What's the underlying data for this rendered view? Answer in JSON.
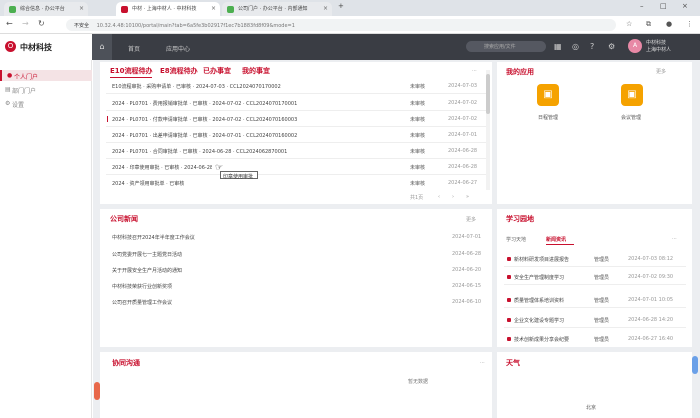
{
  "browser": {
    "tabs": [
      {
        "label": "综合信息 · 办公平台"
      },
      {
        "label": "中材 · 上海中材人 · 中材科技"
      },
      {
        "label": "公司门户 · 办公平台 · 内部通知"
      }
    ],
    "address": "10.32.4.48:10100/portal/main?tab=6a5fe3b02917f1ec7b1883fd8f09&mode=1",
    "secure_label": "不安全"
  },
  "app": {
    "logo_text": "中材科技",
    "nav": [
      "首页",
      "应用中心"
    ],
    "search_placeholder": "搜索应用/文件",
    "user_line1": "中材科技",
    "user_line2": "上海中材人"
  },
  "sidebar": {
    "items": [
      {
        "label": "个人门户",
        "icon": "person-icon"
      },
      {
        "label": "部门门户",
        "icon": "department-icon"
      },
      {
        "label": "设置",
        "icon": "gear-icon"
      }
    ]
  },
  "todo": {
    "tabs": [
      "E10流程待办",
      "E8流程待办",
      "已办事宜",
      "我的事宜"
    ],
    "rows": [
      {
        "title": "E10流程审批 · 采购申请单 · 已审核 · 2024-07-03 · CCL2024070170002",
        "status": "未审核",
        "date": "2024-07-03"
      },
      {
        "title": "2024 · PL0701 · 费用报销审批单 · 已审核 · 2024-07-02 · CCL2024070170001",
        "status": "未审核",
        "date": "2024-07-02"
      },
      {
        "title": "2024 · PL0701 · 付款申请审批单 · 已审核 · 2024-07-02 · CCL2024070160003",
        "status": "未审核",
        "date": "2024-07-02"
      },
      {
        "title": "2024 · PL0701 · 出差申请审批单 · 已审核 · 2024-07-01 · CCL2024070160002",
        "status": "未审核",
        "date": "2024-07-01"
      },
      {
        "title": "2024 · PL0701 · 合同审批单 · 已审核 · 2024-06-28 · CCL2024062870001",
        "status": "未审核",
        "date": "2024-06-28"
      },
      {
        "title": "2024 · 印章使用审批 · 已审核 · 2024-06-28",
        "status": "未审核",
        "date": "2024-06-28"
      },
      {
        "title": "2024 · 资产领用审批单 · 已审核",
        "status": "未审核",
        "date": "2024-06-27"
      }
    ],
    "tooltip": "印章使用审批",
    "pager": "共1页"
  },
  "apps": {
    "title": "我的应用",
    "more": "更多",
    "items": [
      {
        "label": "日程管理"
      },
      {
        "label": "会议管理"
      }
    ]
  },
  "notices": {
    "title": "公司新闻",
    "more": "更多",
    "rows": [
      {
        "title": "中材科技召开2024年半年度工作会议",
        "date": "2024-07-01"
      },
      {
        "title": "公司党委开展七一主题党日活动",
        "date": "2024-06-28"
      },
      {
        "title": "关于开展安全生产月活动的通知",
        "date": "2024-06-20"
      },
      {
        "title": "中材科技荣获行业创新奖项",
        "date": "2024-06-15"
      },
      {
        "title": "公司召开质量管理工作会议",
        "date": "2024-06-10"
      }
    ]
  },
  "todo2": {
    "title": "学习园地",
    "tabs": [
      "学习天地",
      "新闻资讯"
    ],
    "rows": [
      {
        "title": "新材料研发项目进展报告",
        "author": "管理员",
        "date": "2024-07-03 08:12"
      },
      {
        "title": "安全生产管理制度学习",
        "author": "管理员",
        "date": "2024-07-02 09:30"
      },
      {
        "title": "质量管理体系培训资料",
        "author": "管理员",
        "date": "2024-07-01 10:05"
      },
      {
        "title": "企业文化建设专题学习",
        "author": "管理员",
        "date": "2024-06-28 14:20"
      },
      {
        "title": "技术创新成果分享会纪要",
        "author": "管理员",
        "date": "2024-06-27 16:40"
      }
    ]
  },
  "bottom_left": {
    "title": "协同沟通",
    "empty": "暂无数据"
  },
  "bottom_right": {
    "title": "天气",
    "city": "北京"
  }
}
